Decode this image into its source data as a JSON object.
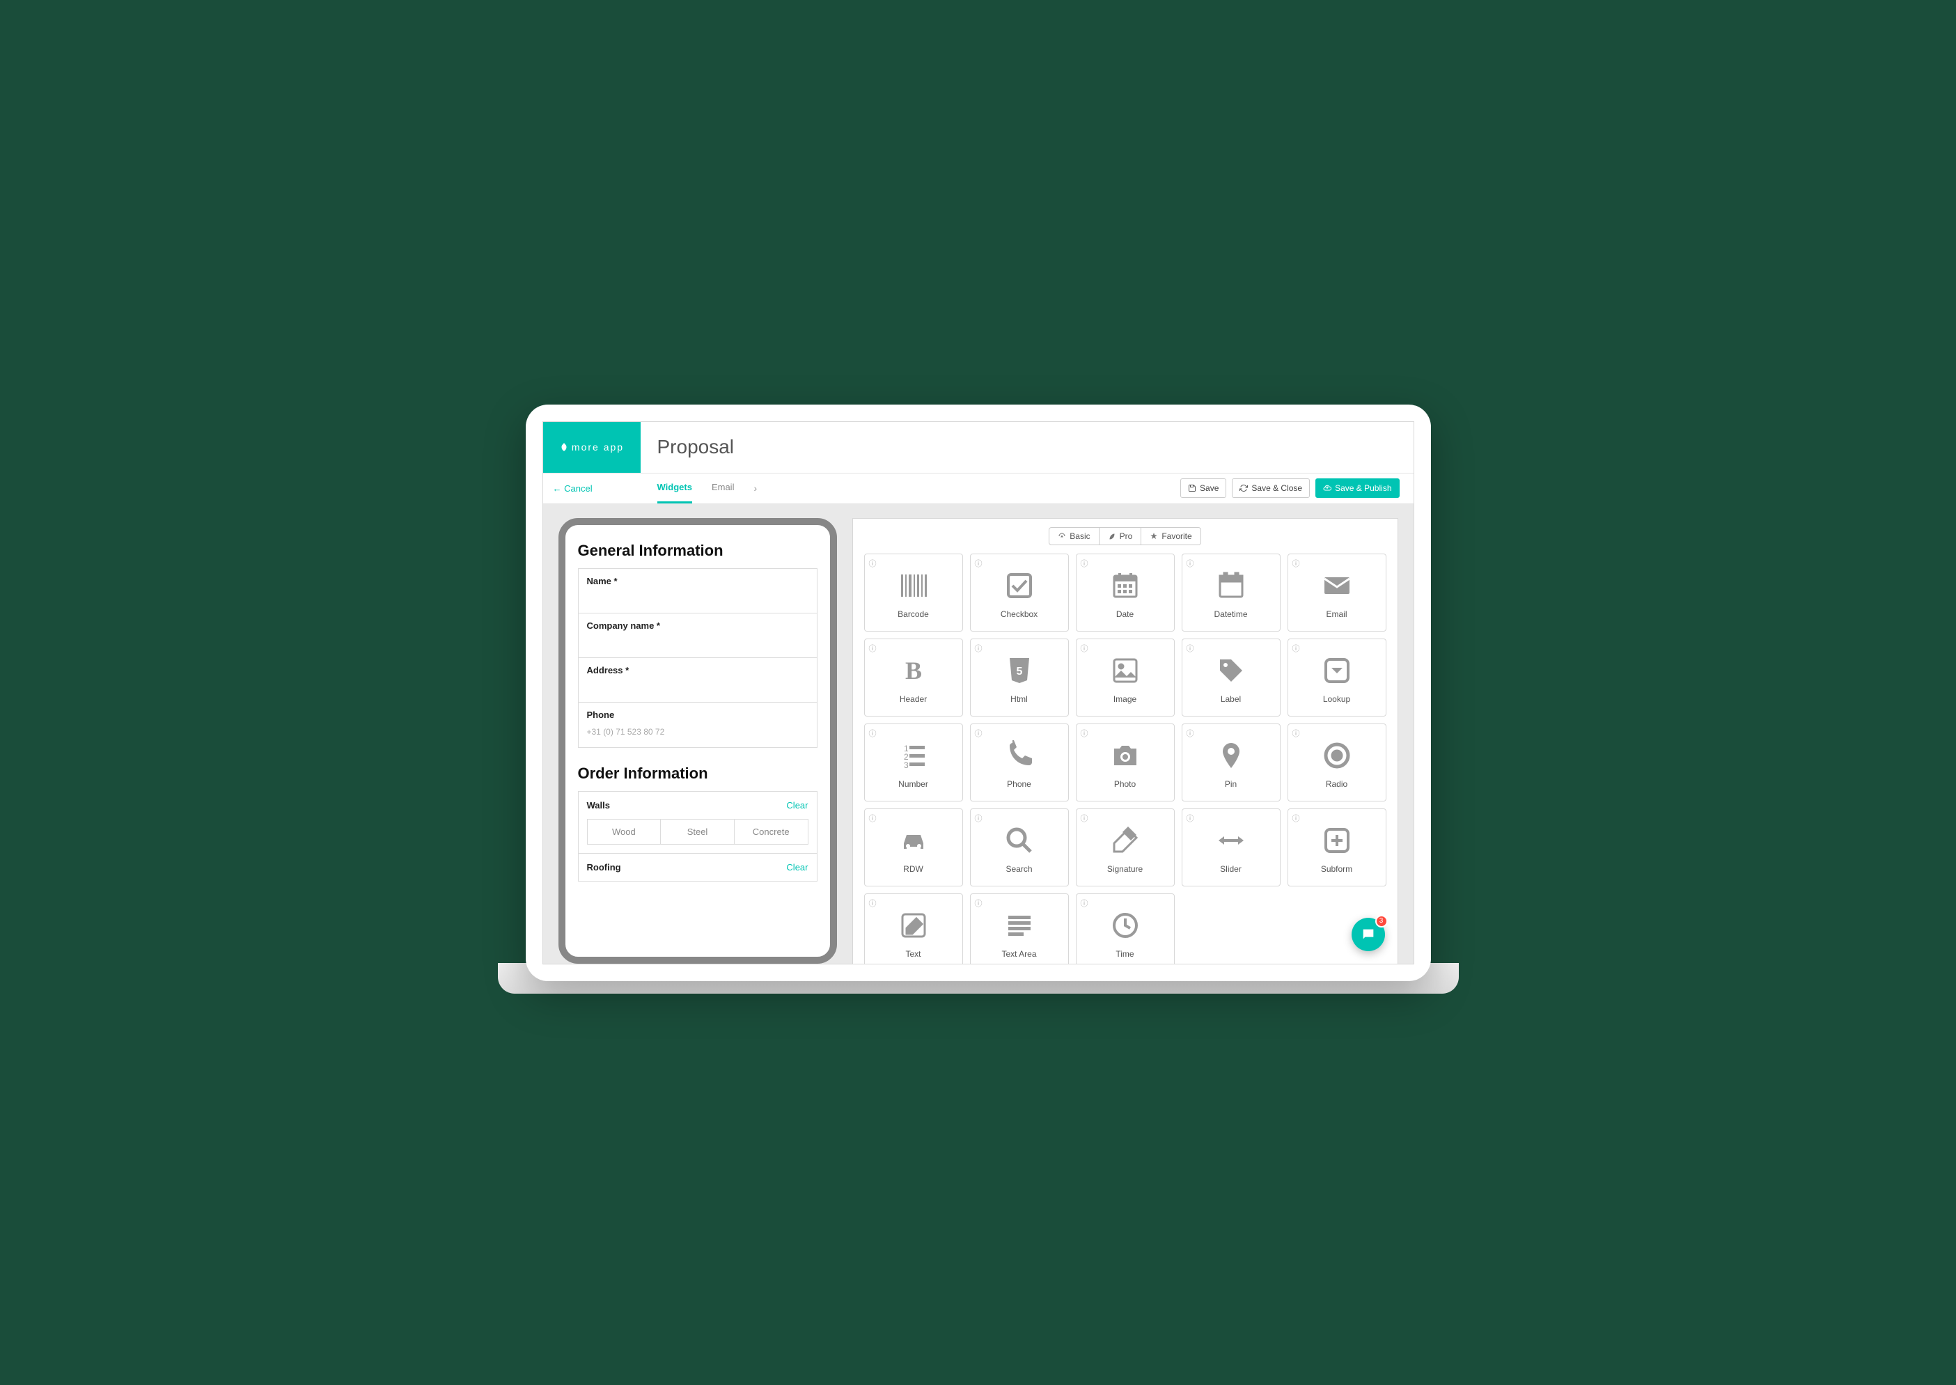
{
  "brand": "more app",
  "page_title": "Proposal",
  "cancel_label": "Cancel",
  "tabs": {
    "widgets": "Widgets",
    "email": "Email"
  },
  "actions": {
    "save": "Save",
    "save_close": "Save & Close",
    "save_publish": "Save & Publish"
  },
  "preview": {
    "section1": "General Information",
    "fields": [
      {
        "label": "Name *"
      },
      {
        "label": "Company name *"
      },
      {
        "label": "Address *"
      },
      {
        "label": "Phone",
        "placeholder": "+31 (0) 71 523 80 72"
      }
    ],
    "section2": "Order Information",
    "walls_label": "Walls",
    "clear_label": "Clear",
    "walls_options": [
      "Wood",
      "Steel",
      "Concrete"
    ],
    "roofing_label": "Roofing"
  },
  "filters": {
    "basic": "Basic",
    "pro": "Pro",
    "favorite": "Favorite"
  },
  "widgets": [
    "Barcode",
    "Checkbox",
    "Date",
    "Datetime",
    "Email",
    "Header",
    "Html",
    "Image",
    "Label",
    "Lookup",
    "Number",
    "Phone",
    "Photo",
    "Pin",
    "Radio",
    "RDW",
    "Search",
    "Signature",
    "Slider",
    "Subform",
    "Text",
    "Text Area",
    "Time"
  ],
  "chat_badge": "3"
}
